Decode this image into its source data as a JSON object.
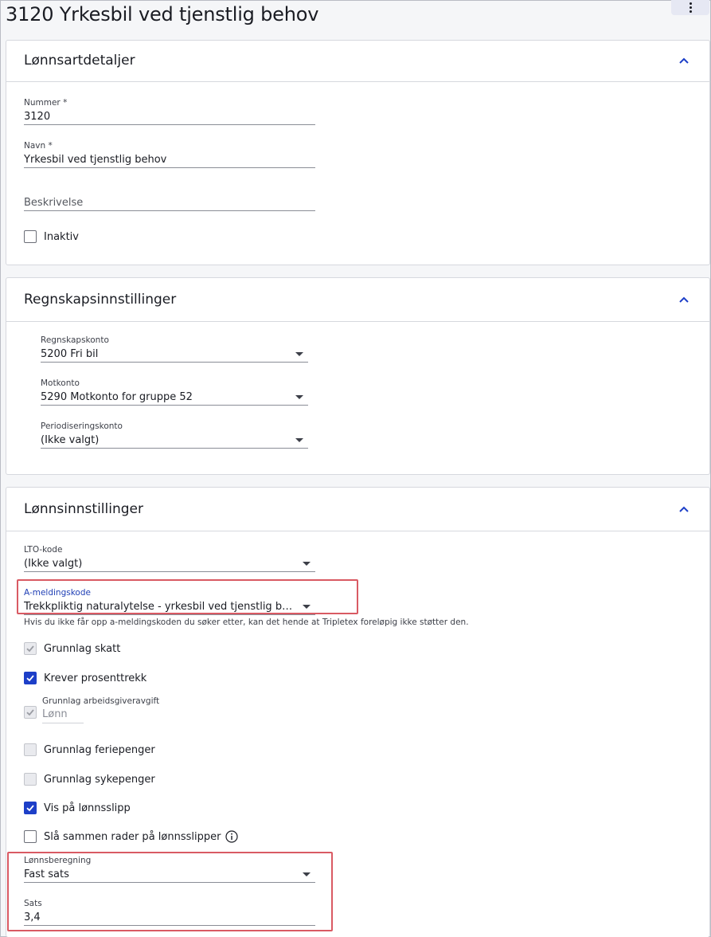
{
  "page": {
    "title": "3120 Yrkesbil ved tjenstlig behov",
    "menu_icon": "kebab-menu-icon"
  },
  "cards": {
    "details": {
      "title": "Lønnsartdetaljer",
      "number_label": "Nummer *",
      "number_value": "3120",
      "name_label": "Navn *",
      "name_value": "Yrkesbil ved tjenstlig behov",
      "description_placeholder": "Beskrivelse",
      "inactive_label": "Inaktiv"
    },
    "accounting": {
      "title": "Regnskapsinnstillinger",
      "account_label": "Regnskapskonto",
      "account_value": "5200 Fri bil",
      "counter_label": "Motkonto",
      "counter_value": "5290 Motkonto for gruppe 52",
      "accrual_label": "Periodiseringskonto",
      "accrual_value": "(Ikke valgt)"
    },
    "salary": {
      "title": "Lønnsinnstillinger",
      "lto_label": "LTO-kode",
      "lto_value": "(Ikke valgt)",
      "amelding_label": "A-meldingskode",
      "amelding_value": "Trekkpliktig naturalytelse - yrkesbil ved tjenstlig behov, kil...",
      "amelding_hint": "Hvis du ikke får opp a-meldingskoden du søker etter, kan det hende at Tripletex foreløpig ikke støtter den.",
      "tax_basis_label": "Grunnlag skatt",
      "percent_tax_label": "Krever prosenttrekk",
      "employer_tax_label": "Grunnlag arbeidsgiveravgift",
      "employer_tax_value": "Lønn",
      "holiday_pay_label": "Grunnlag feriepenger",
      "sick_pay_label": "Grunnlag sykepenger",
      "show_payslip_label": "Vis på lønnsslipp",
      "merge_rows_label": "Slå sammen rader på lønnsslipper",
      "calc_label": "Lønnsberegning",
      "calc_value": "Fast sats",
      "rate_label": "Sats",
      "rate_value": "3,4"
    }
  }
}
